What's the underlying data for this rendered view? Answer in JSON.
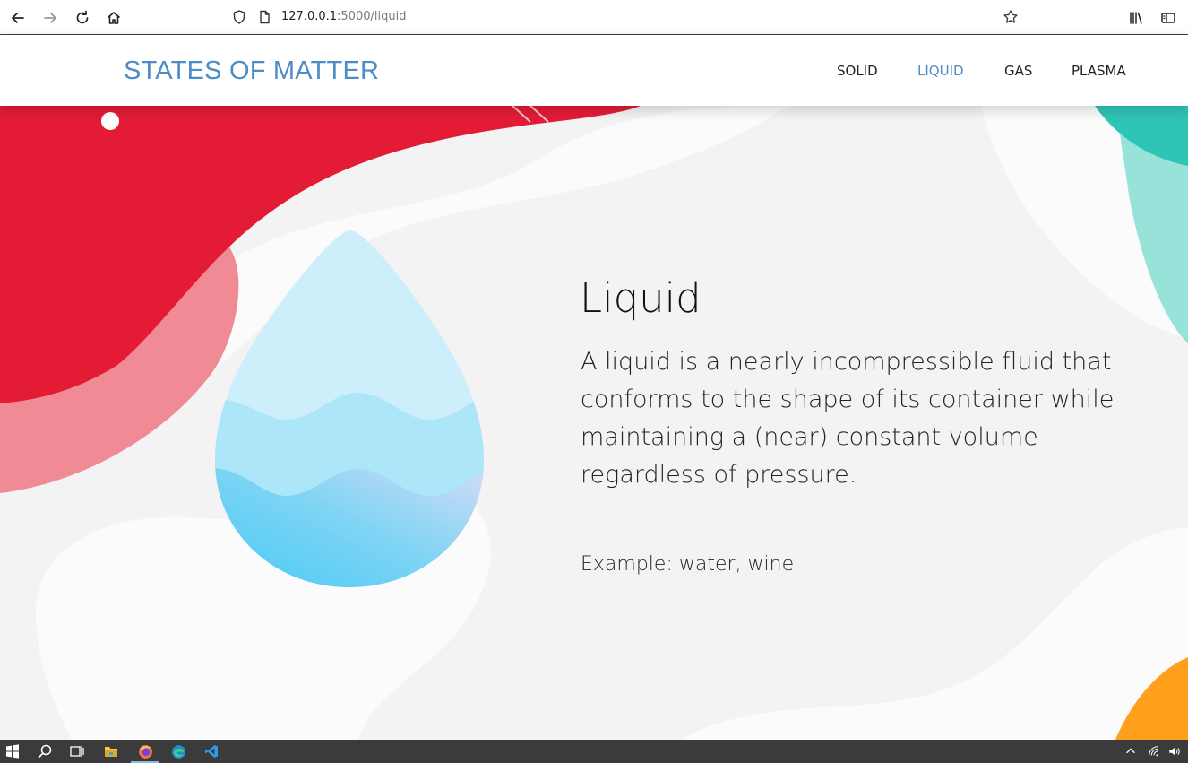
{
  "browser": {
    "url_host": "127.0.0.1",
    "url_path": ":5000/liquid"
  },
  "site": {
    "brand": "STATES OF MATTER",
    "nav": [
      {
        "label": "SOLID",
        "active": false
      },
      {
        "label": "LIQUID",
        "active": true
      },
      {
        "label": "GAS",
        "active": false
      },
      {
        "label": "PLASMA",
        "active": false
      }
    ]
  },
  "content": {
    "title": "Liquid",
    "description": "A liquid is a nearly incompressible fluid that conforms to the shape of its container while maintaining a (near) constant volume regardless of pressure.",
    "example": "Example: water, wine"
  },
  "colors": {
    "brand": "#4d8cc6",
    "blob_red": "#e31b35",
    "blob_pink": "#f08b96",
    "blob_teal": "#2ec4b6",
    "blob_orange": "#ffa01c",
    "drop_light": "#cdeffb",
    "drop_mid": "#aee6f9",
    "drop_deep": "#3ec9f6"
  },
  "taskbar": {
    "apps": [
      "windows-start-icon",
      "search-icon",
      "task-view-icon",
      "file-explorer-icon",
      "firefox-icon",
      "edge-icon",
      "vscode-icon"
    ]
  }
}
